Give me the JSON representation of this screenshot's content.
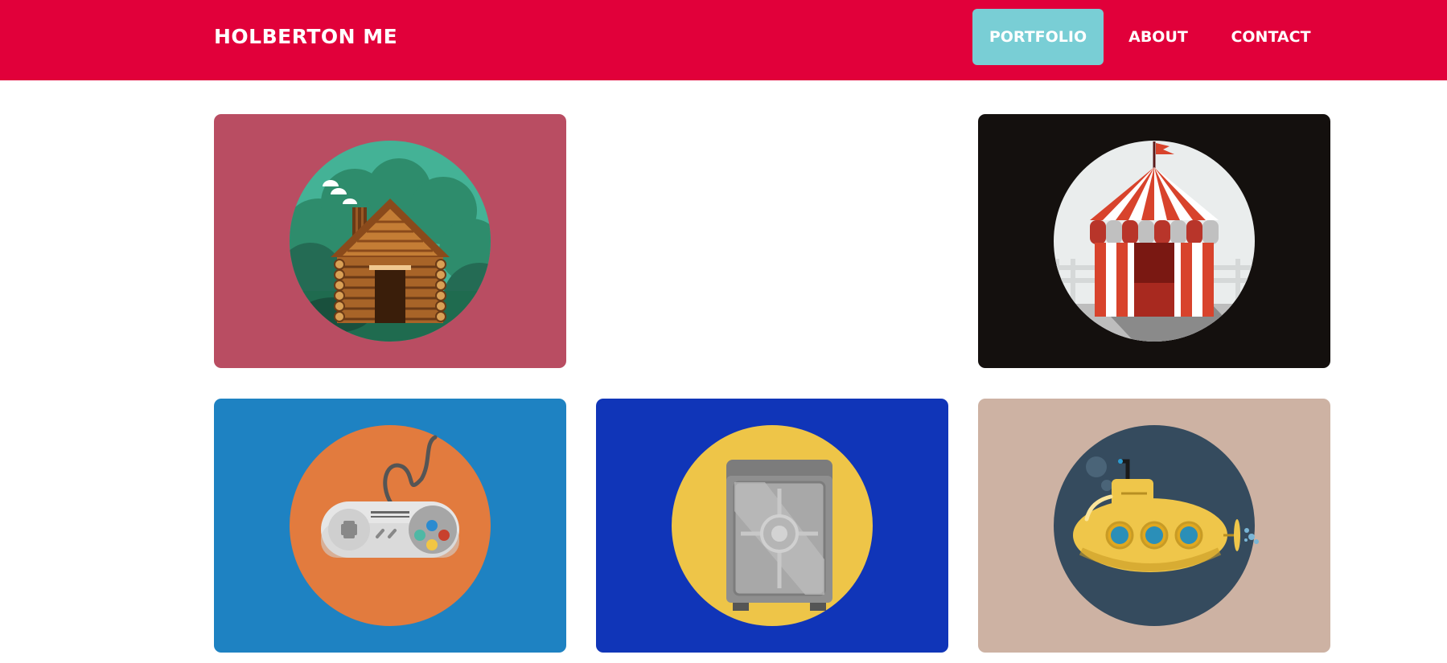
{
  "navbar": {
    "brand": "HOLBERTON ME",
    "items": [
      {
        "label": "PORTFOLIO",
        "active": true
      },
      {
        "label": "ABOUT",
        "active": false
      },
      {
        "label": "CONTACT",
        "active": false
      }
    ],
    "background_color": "#e1003a",
    "active_color": "#79ced5"
  },
  "portfolio": {
    "cards": [
      {
        "icon": "log-cabin-icon",
        "background_color": "#b94d62",
        "circle_color": "#44b296"
      },
      {
        "icon": "circus-tent-icon",
        "background_color": "#14100e",
        "circle_color": "#eaeded"
      },
      {
        "icon": "game-controller-icon",
        "background_color": "#1e82c2",
        "circle_color": "#e27b3e"
      },
      {
        "icon": "safe-icon",
        "background_color": "#1035b8",
        "circle_color": "#eec548"
      },
      {
        "icon": "submarine-icon",
        "background_color": "#cdb2a3",
        "circle_color": "#354b5e"
      }
    ]
  }
}
